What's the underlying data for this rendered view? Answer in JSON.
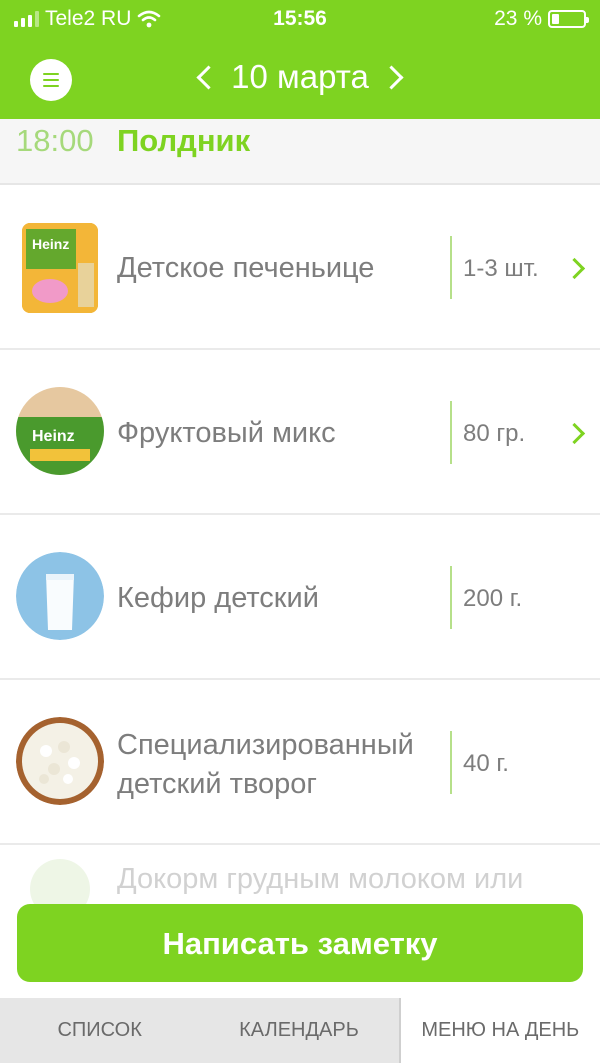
{
  "status_bar": {
    "carrier": "Tele2 RU",
    "time": "15:56",
    "battery_percent": "23 %",
    "battery_level": 0.23
  },
  "header": {
    "date": "10 марта",
    "background_color": "#7ed321"
  },
  "meal": {
    "time": "18:00",
    "name": "Полдник"
  },
  "items": [
    {
      "title": "Детское печеньице",
      "amount": "1-3 шт.",
      "icon": "biscuit-box-icon",
      "has_arrow": true
    },
    {
      "title": "Фруктовый микс",
      "amount": "80 гр.",
      "icon": "fruit-puree-jar-icon",
      "has_arrow": true
    },
    {
      "title": "Кефир детский",
      "amount": "200 г.",
      "icon": "kefir-glass-icon",
      "has_arrow": false
    },
    {
      "title_line1": "Специализированный",
      "title_line2": "детский творог",
      "amount": "40 г.",
      "icon": "cottage-cheese-bowl-icon",
      "has_arrow": false
    }
  ],
  "partial_item": {
    "title": "Докорм грудным молоком или"
  },
  "note_button": "Написать заметку",
  "tabs": [
    "СПИСОК",
    "КАЛЕНДАРЬ",
    "МЕНЮ НА ДЕНЬ"
  ],
  "active_tab": "МЕНЮ НА ДЕНЬ",
  "accent_color": "#7ed321"
}
